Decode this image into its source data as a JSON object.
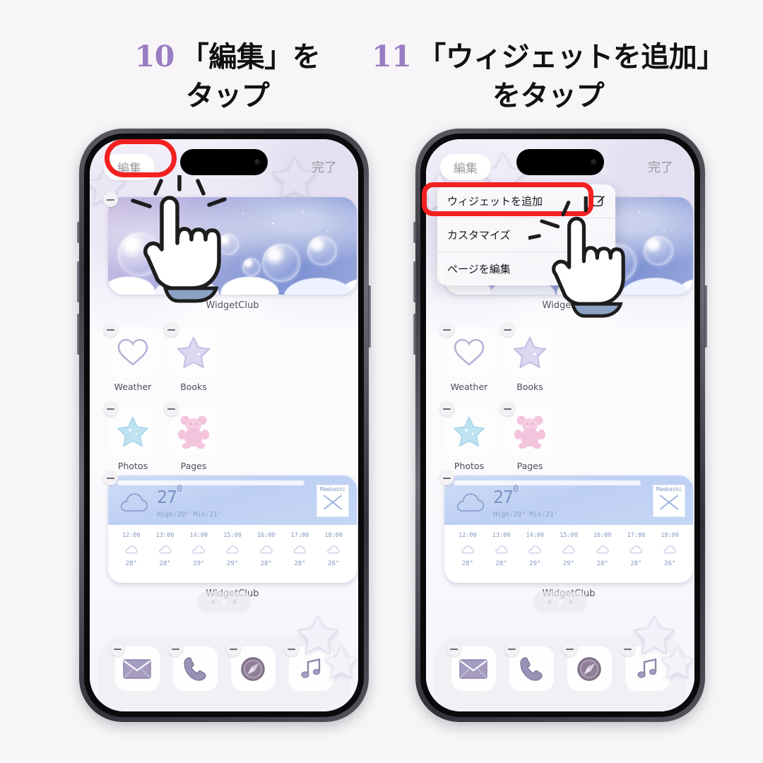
{
  "background_color": "#f7f5f7",
  "accent_purple": "#9b7cc2",
  "highlight_red": "#f32020",
  "headings": [
    {
      "number": "10",
      "line1": "「編集」を",
      "line2": "タップ"
    },
    {
      "number": "11",
      "line1": "「ウィジェットを追加」",
      "line2": "をタップ"
    }
  ],
  "phone": {
    "status_bar": {
      "edit_label": "編集",
      "done_label": "完了"
    },
    "hero_widget": {
      "label": "WidgetClub"
    },
    "apps": [
      {
        "label": "Weather",
        "icon": "heart-icon"
      },
      {
        "label": "Books",
        "icon": "star-purple-icon"
      },
      {
        "label": "Photos",
        "icon": "star-blue-icon"
      },
      {
        "label": "Pages",
        "icon": "gummy-bear-icon"
      }
    ],
    "weather_widget": {
      "label": "WidgetClub",
      "temp": "27",
      "temp_unit": "0",
      "high_low": "High:29° Min:21°",
      "location": "Maebashi",
      "hours": [
        {
          "time": "12:00",
          "temp": "28°"
        },
        {
          "time": "13:00",
          "temp": "28°"
        },
        {
          "time": "14:00",
          "temp": "29°"
        },
        {
          "time": "15:00",
          "temp": "29°"
        },
        {
          "time": "16:00",
          "temp": "28°"
        },
        {
          "time": "17:00",
          "temp": "28°"
        },
        {
          "time": "18:00",
          "temp": "26°"
        }
      ]
    },
    "dock": [
      {
        "icon": "mail-icon"
      },
      {
        "icon": "phone-icon"
      },
      {
        "icon": "safari-icon"
      },
      {
        "icon": "music-icon"
      }
    ]
  },
  "context_menu": {
    "items": [
      {
        "label": "ウィジェットを追加",
        "icon": "edit-square-icon",
        "highlighted": true
      },
      {
        "label": "カスタマイズ",
        "icon": "",
        "highlighted": false
      },
      {
        "label": "ページを編集",
        "icon": "",
        "highlighted": false
      }
    ]
  }
}
